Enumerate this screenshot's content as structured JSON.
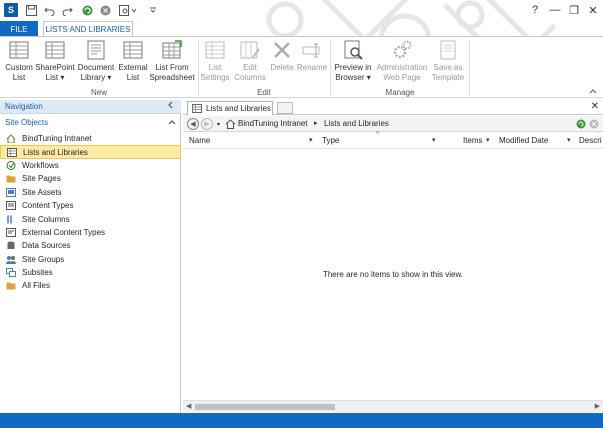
{
  "window": {
    "help_label": "?",
    "minimize_label": "—",
    "restore_label": "❐",
    "close_label": "✕",
    "app_logo_text": "S"
  },
  "tabs": {
    "file": "FILE",
    "lists": "LISTS AND LIBRARIES"
  },
  "ribbon": {
    "groups": {
      "new": "New",
      "edit": "Edit",
      "manage": "Manage"
    },
    "buttons": {
      "custom_list": [
        "Custom",
        "List"
      ],
      "sharepoint_list": [
        "SharePoint",
        "List ▾"
      ],
      "document_library": [
        "Document",
        "Library ▾"
      ],
      "external_list": [
        "External",
        "List"
      ],
      "list_from_spreadsheet": [
        "List From",
        "Spreadsheet"
      ],
      "list_settings": [
        "List",
        "Settings"
      ],
      "edit_columns": [
        "Edit",
        "Columns"
      ],
      "delete": [
        "Delete",
        ""
      ],
      "rename": [
        "Rename",
        ""
      ],
      "preview_in_browser": [
        "Preview in",
        "Browser ▾"
      ],
      "administration_web_page": [
        "Administration",
        "Web Page"
      ],
      "save_as_template": [
        "Save as",
        "Template"
      ]
    }
  },
  "nav": {
    "header": "Navigation",
    "section": "Site Objects",
    "items": [
      {
        "label": "BindTuning Intranet",
        "icon": "site-home-icon",
        "color": "#8a6d3b"
      },
      {
        "label": "Lists and Libraries",
        "icon": "list-icon",
        "color": "#555555",
        "selected": true
      },
      {
        "label": "Workflows",
        "icon": "workflow-icon",
        "color": "#2b7a2b"
      },
      {
        "label": "Site Pages",
        "icon": "site-pages-icon",
        "color": "#d9a441"
      },
      {
        "label": "Site Assets",
        "icon": "site-assets-icon",
        "color": "#4a7fb5"
      },
      {
        "label": "Content Types",
        "icon": "content-types-icon",
        "color": "#555555"
      },
      {
        "label": "Site Columns",
        "icon": "site-columns-icon",
        "color": "#4a7fb5"
      },
      {
        "label": "External Content Types",
        "icon": "external-content-types-icon",
        "color": "#555555"
      },
      {
        "label": "Data Sources",
        "icon": "data-sources-icon",
        "color": "#666666"
      },
      {
        "label": "Site Groups",
        "icon": "site-groups-icon",
        "color": "#4a7fb5"
      },
      {
        "label": "Subsites",
        "icon": "subsites-icon",
        "color": "#4a7fb5"
      },
      {
        "label": "All Files",
        "icon": "all-files-icon",
        "color": "#d9a441"
      }
    ]
  },
  "content": {
    "tab_label": "Lists and Libraries",
    "breadcrumb": [
      "BindTuning Intranet",
      "Lists and Libraries"
    ],
    "columns": [
      "Name",
      "Type",
      "Items",
      "Modified Date",
      "Descri"
    ],
    "empty_message": "There are no items to show in this view."
  },
  "colors": {
    "accent": "#0f6ac2",
    "selected_bg": "#fee9a5",
    "nav_header_bg": "#dfe9f5"
  }
}
